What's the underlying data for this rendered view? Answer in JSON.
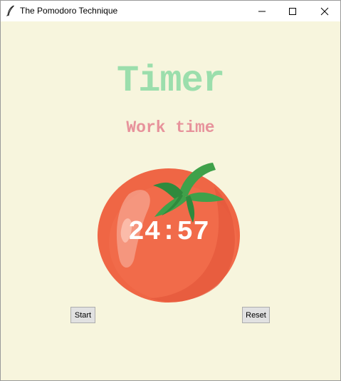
{
  "window": {
    "title": "The Pomodoro Technique",
    "controls": [
      "minimize",
      "maximize",
      "close"
    ]
  },
  "app": {
    "heading": "Timer",
    "status": "Work time",
    "countdown": "24:57",
    "start_label": "Start",
    "reset_label": "Reset"
  },
  "colors": {
    "background": "#f7f5dd",
    "heading": "#9bdeac",
    "status": "#e7929b",
    "tomato": "#ef6645",
    "leaves": "#3fa14a",
    "countdown": "#ffffff"
  },
  "icons": {
    "app_icon": "feather-icon",
    "tomato_image": "tomato-image"
  }
}
